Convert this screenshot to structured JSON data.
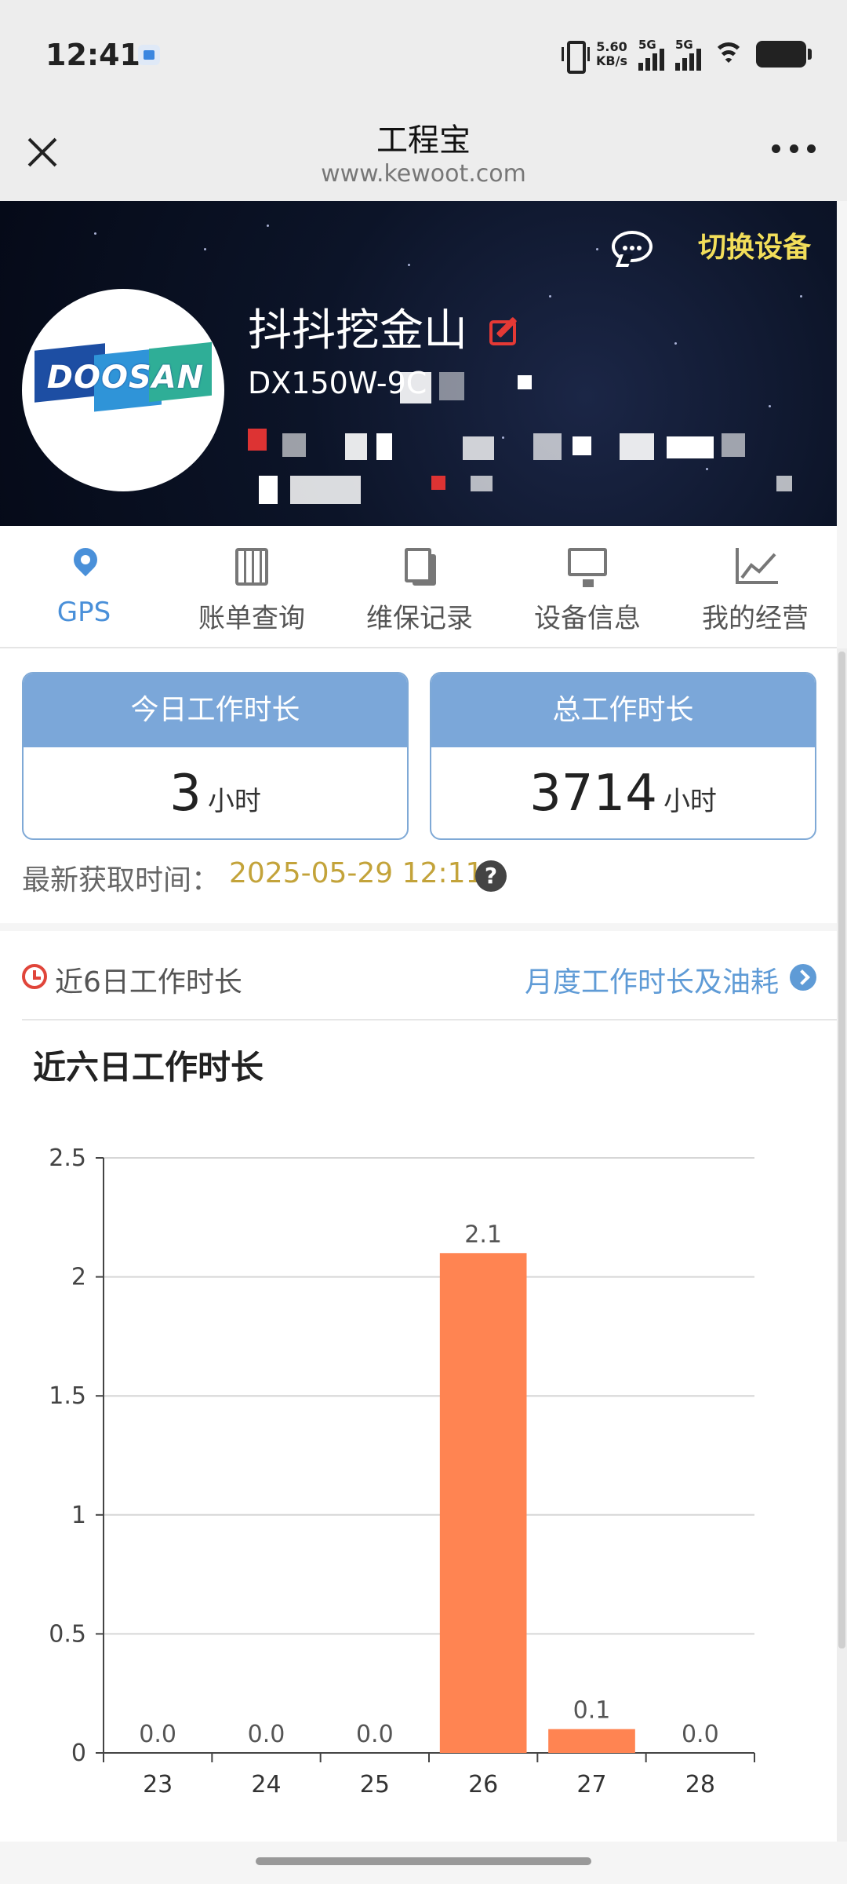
{
  "status_bar": {
    "time": "12:41",
    "net_speed_value": "5.60",
    "net_speed_unit": "KB/s",
    "signal1_label": "5G",
    "signal2_label": "5G"
  },
  "nav": {
    "title": "工程宝",
    "url": "www.kewoot.com"
  },
  "hero": {
    "switch_label": "切换设备",
    "device_name": "抖抖挖金山",
    "device_model": "DX150W-9C",
    "logo_text": "DOOSAN"
  },
  "menu": [
    {
      "label": "GPS",
      "icon": "location-pin-icon",
      "active": true
    },
    {
      "label": "账单查询",
      "icon": "calculator-icon",
      "active": false
    },
    {
      "label": "维保记录",
      "icon": "document-icon",
      "active": false
    },
    {
      "label": "设备信息",
      "icon": "monitor-icon",
      "active": false
    },
    {
      "label": "我的经营",
      "icon": "trend-chart-icon",
      "active": false
    }
  ],
  "stats": {
    "today": {
      "title": "今日工作时长",
      "value": "3",
      "unit": "小时"
    },
    "total": {
      "title": "总工作时长",
      "value": "3714",
      "unit": "小时"
    },
    "fetch_label": "最新获取时间：",
    "fetch_time": "2025-05-29 12:11"
  },
  "section": {
    "title": "近6日工作时长",
    "link": "月度工作时长及油耗"
  },
  "colors": {
    "accent": "#4a90d9",
    "card_header": "#7ba7d9",
    "bar": "#ff8452",
    "date_text": "#c3a33a",
    "switch_text": "#f2de5a"
  },
  "chart_data": {
    "type": "bar",
    "title": "近六日工作时长",
    "categories": [
      "23",
      "24",
      "25",
      "26",
      "27",
      "28"
    ],
    "values": [
      0.0,
      0.0,
      0.0,
      2.1,
      0.1,
      0.0
    ],
    "data_labels": [
      "0.0",
      "0.0",
      "0.0",
      "2.1",
      "0.1",
      "0.0"
    ],
    "ylim": [
      0,
      2.5
    ],
    "yticks": [
      "0",
      "0.5",
      "1",
      "1.5",
      "2",
      "2.5"
    ],
    "grid": true,
    "xlabel": "",
    "ylabel": ""
  }
}
